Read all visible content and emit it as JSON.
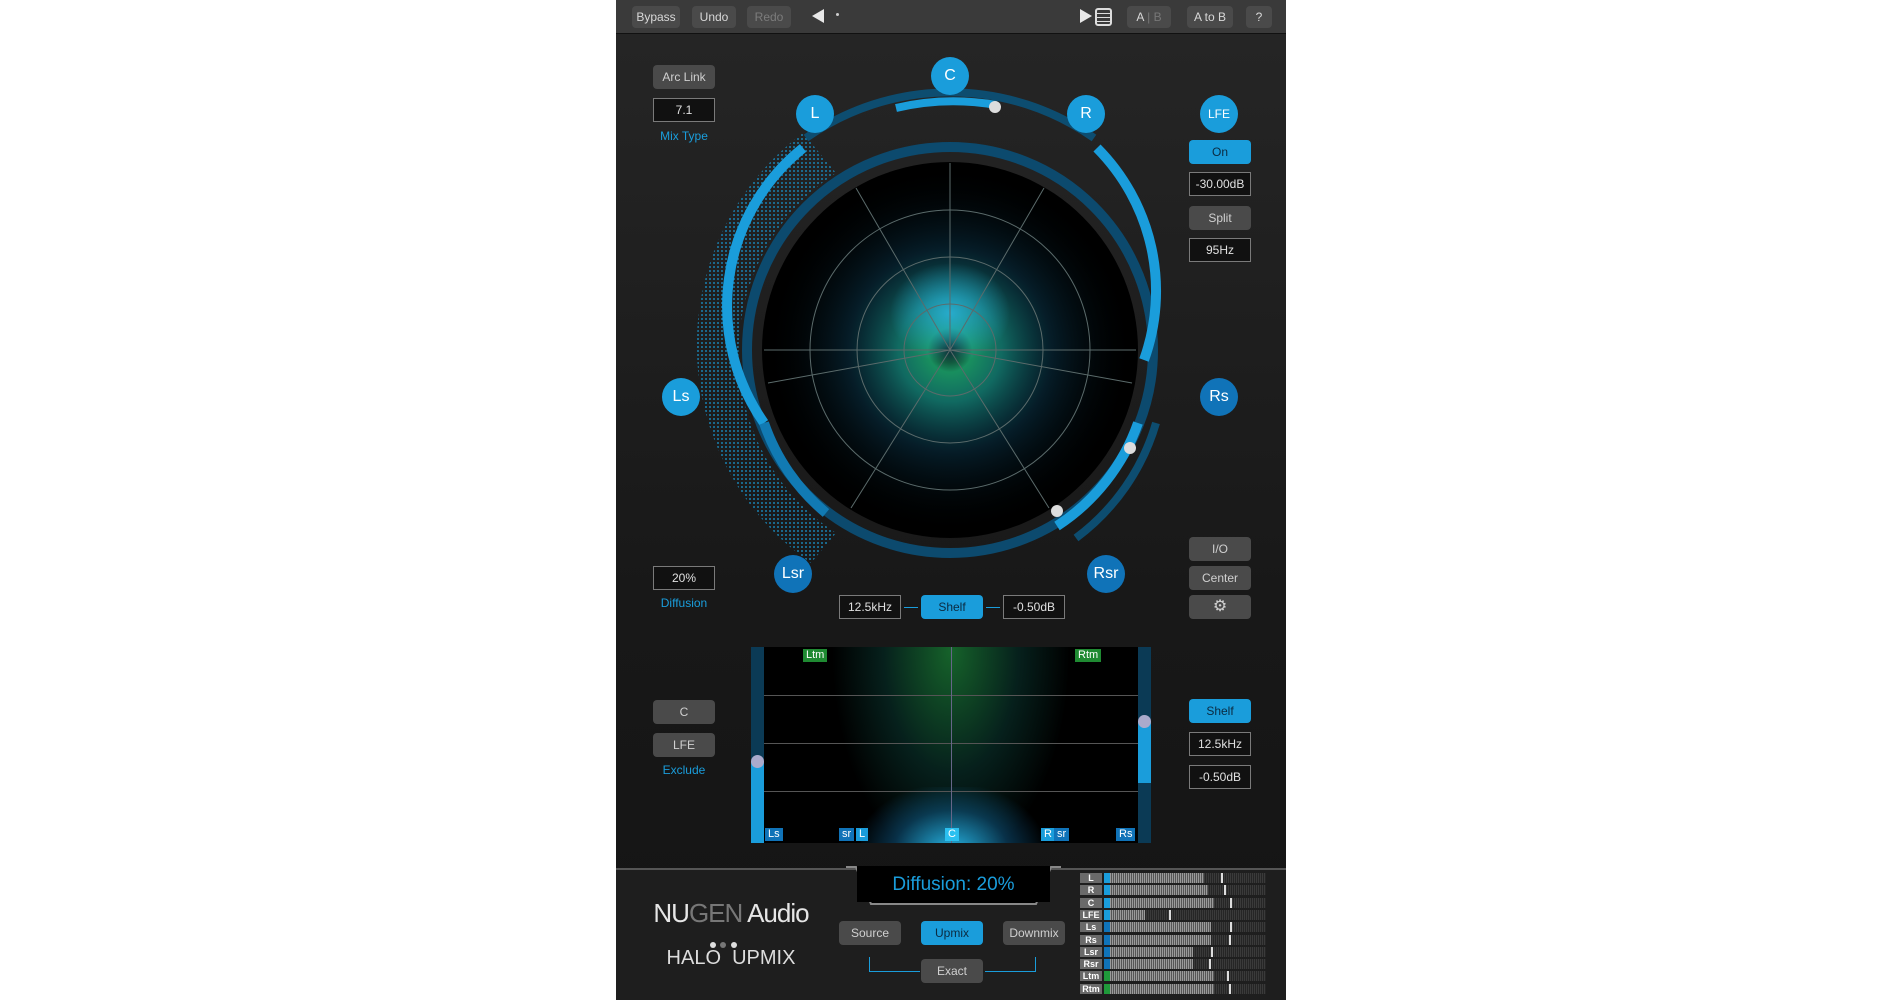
{
  "toolbar": {
    "bypass": "Bypass",
    "undo": "Undo",
    "redo": "Redo",
    "prev_icon": "triangle-left-icon",
    "next_icon": "triangle-right-icon",
    "preset_menu_icon": "list-icon",
    "ab": "A",
    "ab_b": "B",
    "a_to_b": "A to B",
    "help": "?"
  },
  "left": {
    "arc_link": "Arc Link",
    "mix_type_value": "7.1",
    "mix_type_label": "Mix Type",
    "diffusion_value": "20%",
    "diffusion_label": "Diffusion",
    "exclude_c": "C",
    "exclude_lfe": "LFE",
    "exclude_label": "Exclude"
  },
  "speakers": {
    "C": "C",
    "L": "L",
    "R": "R",
    "Ls": "Ls",
    "Rs": "Rs",
    "Lsr": "Lsr",
    "Rsr": "Rsr",
    "LFE": "LFE"
  },
  "right": {
    "lfe_on": "On",
    "lfe_gain": "-30.00dB",
    "split": "Split",
    "split_freq": "95Hz",
    "io": "I/O",
    "center": "Center",
    "settings_icon": "gear-icon",
    "height_shelf": "Shelf",
    "height_freq": "12.5kHz",
    "height_gain": "-0.50dB"
  },
  "shelf_row": {
    "freq": "12.5kHz",
    "mode": "Shelf",
    "gain": "-0.50dB"
  },
  "height_view": {
    "top_labels": [
      "Ltm",
      "Rtm"
    ],
    "bottom_labels": [
      "Ls",
      "sr",
      "L",
      "C",
      "R",
      "sr",
      "Rs"
    ],
    "left_slider_level": 0.42,
    "right_slider_level": 0.62
  },
  "footer": {
    "brand_nu": "NU",
    "brand_gen": "GEN",
    "brand_audio": " Audio",
    "product": "HALO  UPMIX",
    "status": "Diffusion: 20%",
    "source": "Source",
    "upmix": "Upmix",
    "downmix": "Downmix",
    "exact": "Exact"
  },
  "meters": [
    {
      "label": "L",
      "level": 0.62,
      "peak": 0.72,
      "color": "#1a9ddb"
    },
    {
      "label": "R",
      "level": 0.64,
      "peak": 0.74,
      "color": "#1a9ddb"
    },
    {
      "label": "C",
      "level": 0.68,
      "peak": 0.78,
      "color": "#1a9ddb"
    },
    {
      "label": "LFE",
      "level": 0.25,
      "peak": 0.4,
      "color": "#1a9ddb"
    },
    {
      "label": "Ls",
      "level": 0.66,
      "peak": 0.78,
      "color": "#1073b8"
    },
    {
      "label": "Rs",
      "level": 0.66,
      "peak": 0.77,
      "color": "#1073b8"
    },
    {
      "label": "Lsr",
      "level": 0.55,
      "peak": 0.66,
      "color": "#1073b8"
    },
    {
      "label": "Rsr",
      "level": 0.55,
      "peak": 0.65,
      "color": "#1073b8"
    },
    {
      "label": "Ltm",
      "level": 0.68,
      "peak": 0.76,
      "color": "#1f9a3a"
    },
    {
      "label": "Rtm",
      "level": 0.68,
      "peak": 0.77,
      "color": "#1f9a3a"
    }
  ]
}
